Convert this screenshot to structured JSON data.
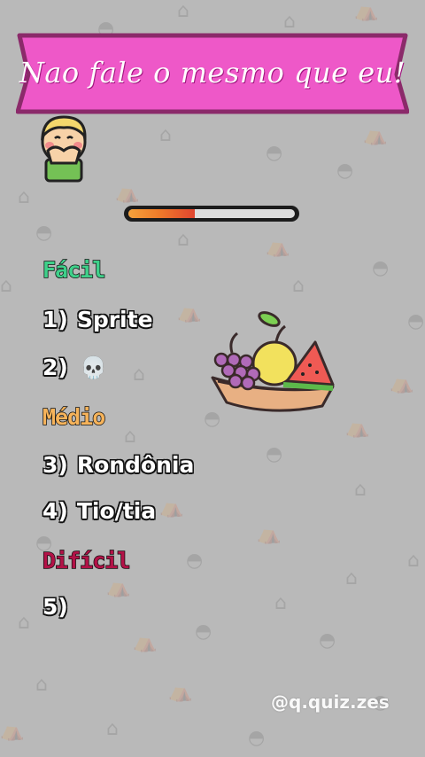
{
  "title": "Nao fale o mesmo que eu!",
  "progress": {
    "fraction": 0.4
  },
  "levels": {
    "easy": "Fácil",
    "medium": "Médio",
    "hard": "Difícil"
  },
  "answers": [
    {
      "num": "1)",
      "text": "Sprite"
    },
    {
      "num": "2)",
      "text": "💀"
    },
    {
      "num": "3)",
      "text": "Rondônia"
    },
    {
      "num": "4)",
      "text": "Tio/tia"
    },
    {
      "num": "5)",
      "text": ""
    }
  ],
  "handle": "@q.quiz.zes",
  "colors": {
    "background": "#b9b9b9",
    "banner": "#ee58c8",
    "banner_border": "#8b2a6a",
    "easy": "#3fd08a",
    "medium": "#f6b35a",
    "hard": "#b21247"
  },
  "icons": {
    "avatar": "child-covering-mouth-icon",
    "fruit": "fruit-basket-icon",
    "skull": "skull-emoji"
  }
}
